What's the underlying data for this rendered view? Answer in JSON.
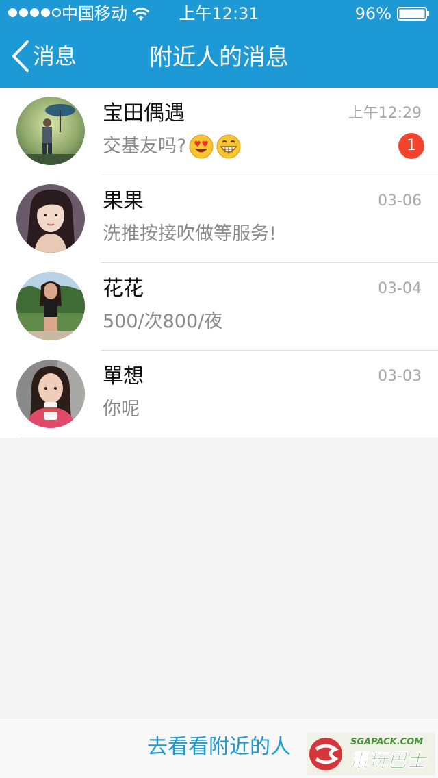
{
  "status_bar": {
    "carrier": "中国移动",
    "time": "上午12:31",
    "battery_percent": "96%",
    "signal_bars_filled": 4,
    "signal_bars_total": 5,
    "battery_level": 0.96,
    "icons": [
      "signal-dots",
      "wifi-icon",
      "battery-icon"
    ]
  },
  "nav": {
    "back_label": "消息",
    "title": "附近人的消息",
    "icons": [
      "back-chevron-icon"
    ]
  },
  "conversations": [
    {
      "name": "宝田偶遇",
      "time": "上午12:29",
      "preview": "交基友吗?",
      "emojis": [
        "heart-eyes-emoji-icon",
        "grinning-emoji-icon"
      ],
      "unread": "1",
      "avatar": "avatar-umbrella-icon"
    },
    {
      "name": "果果",
      "time": "03-06",
      "preview": "洗推按接吹做等服务!",
      "avatar": "avatar-girl-icon"
    },
    {
      "name": "花花",
      "time": "03-04",
      "preview": "500/次800/夜",
      "avatar": "avatar-girl-outdoor-icon"
    },
    {
      "name": "單想",
      "time": "03-03",
      "preview": "你呢",
      "avatar": "avatar-girl-cup-icon"
    }
  ],
  "footer": {
    "link_label": "去看看附近的人"
  },
  "watermark": {
    "top_text": "SGAPACK.COM",
    "main_text": "電玩巴士"
  },
  "colors": {
    "accent": "#1d9ad6",
    "badge": "#f2442c",
    "background": "#f5f5f5"
  }
}
